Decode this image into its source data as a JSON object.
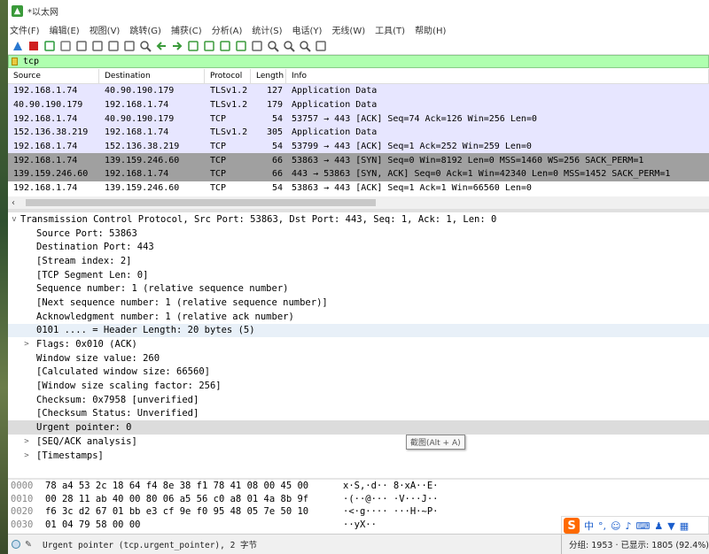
{
  "window": {
    "title": "*以太网"
  },
  "menu": [
    "文件(F)",
    "编辑(E)",
    "视图(V)",
    "跳转(G)",
    "捕获(C)",
    "分析(A)",
    "统计(S)",
    "电话(Y)",
    "无线(W)",
    "工具(T)",
    "帮助(H)"
  ],
  "toolbar_icons": [
    "shark-fin-icon",
    "stop-icon",
    "restart-icon",
    "options-icon",
    "open-icon",
    "save-icon",
    "close-file-icon",
    "reload-icon",
    "find-icon",
    "back-icon",
    "forward-icon",
    "goto-icon",
    "first-icon",
    "last-icon",
    "autoscroll-icon",
    "colorize-icon",
    "zoom-in-icon",
    "zoom-out-icon",
    "zoom-reset-icon",
    "resize-columns-icon"
  ],
  "filter": {
    "value": "tcp"
  },
  "packet_list": {
    "columns": [
      "Source",
      "Destination",
      "Protocol",
      "Length",
      "Info"
    ],
    "rows": [
      {
        "src": "192.168.1.74",
        "dst": "40.90.190.179",
        "proto": "TLSv1.2",
        "len": "127",
        "info": "Application Data",
        "style": "tls"
      },
      {
        "src": "40.90.190.179",
        "dst": "192.168.1.74",
        "proto": "TLSv1.2",
        "len": "179",
        "info": "Application Data",
        "style": "tls"
      },
      {
        "src": "192.168.1.74",
        "dst": "40.90.190.179",
        "proto": "TCP",
        "len": "54",
        "info": "53757 → 443 [ACK] Seq=74 Ack=126 Win=256 Len=0",
        "style": "tls"
      },
      {
        "src": "152.136.38.219",
        "dst": "192.168.1.74",
        "proto": "TLSv1.2",
        "len": "305",
        "info": "Application Data",
        "style": "tls"
      },
      {
        "src": "192.168.1.74",
        "dst": "152.136.38.219",
        "proto": "TCP",
        "len": "54",
        "info": "53799 → 443 [ACK] Seq=1 Ack=252 Win=259 Len=0",
        "style": "tls"
      },
      {
        "src": "192.168.1.74",
        "dst": "139.159.246.60",
        "proto": "TCP",
        "len": "66",
        "info": "53863 → 443 [SYN] Seq=0 Win=8192 Len=0 MSS=1460 WS=256 SACK_PERM=1",
        "style": "syn"
      },
      {
        "src": "139.159.246.60",
        "dst": "192.168.1.74",
        "proto": "TCP",
        "len": "66",
        "info": "443 → 53863 [SYN, ACK] Seq=0 Ack=1 Win=42340 Len=0 MSS=1452 SACK_PERM=1",
        "style": "syn"
      },
      {
        "src": "192.168.1.74",
        "dst": "139.159.246.60",
        "proto": "TCP",
        "len": "54",
        "info": "53863 → 443 [ACK] Seq=1 Ack=1 Win=66560 Len=0",
        "style": "sel"
      }
    ]
  },
  "detail": {
    "header": "Transmission Control Protocol, Src Port: 53863, Dst Port: 443, Seq: 1, Ack: 1, Len: 0",
    "lines": [
      {
        "text": "Source Port: 53863",
        "toggle": ""
      },
      {
        "text": "Destination Port: 443",
        "toggle": ""
      },
      {
        "text": "[Stream index: 2]",
        "toggle": ""
      },
      {
        "text": "[TCP Segment Len: 0]",
        "toggle": ""
      },
      {
        "text": "Sequence number: 1    (relative sequence number)",
        "toggle": ""
      },
      {
        "text": "[Next sequence number: 1    (relative sequence number)]",
        "toggle": ""
      },
      {
        "text": "Acknowledgment number: 1    (relative ack number)",
        "toggle": ""
      },
      {
        "text": "0101 .... = Header Length: 20 bytes (5)",
        "toggle": "",
        "style": "hl"
      },
      {
        "text": "Flags: 0x010 (ACK)",
        "toggle": ">"
      },
      {
        "text": "Window size value: 260",
        "toggle": ""
      },
      {
        "text": "[Calculated window size: 66560]",
        "toggle": ""
      },
      {
        "text": "[Window size scaling factor: 256]",
        "toggle": ""
      },
      {
        "text": "Checksum: 0x7958 [unverified]",
        "toggle": ""
      },
      {
        "text": "[Checksum Status: Unverified]",
        "toggle": ""
      },
      {
        "text": "Urgent pointer: 0",
        "toggle": "",
        "style": "sel"
      },
      {
        "text": "[SEQ/ACK analysis]",
        "toggle": ">"
      },
      {
        "text": "[Timestamps]",
        "toggle": ">"
      }
    ]
  },
  "tooltip": "截图(Alt + A)",
  "hex": [
    {
      "off": "0000",
      "bytes": "78 a4 53 2c 18 64 f4 8e  38 f1 78 41 08 00 45 00",
      "ascii": "x·S,·d··  8·xA··E·"
    },
    {
      "off": "0010",
      "bytes": "00 28 11 ab 40 00 80 06  a5 56 c0 a8 01 4a 8b 9f",
      "ascii": "·(··@···  ·V···J··"
    },
    {
      "off": "0020",
      "bytes": "f6 3c d2 67 01 bb e3 cf  9e f0 95 48 05 7e 50 10",
      "ascii": "·<·g····  ···H·~P·"
    },
    {
      "off": "0030",
      "bytes": "01 04 79 58 00 00",
      "ascii": "··yX··"
    }
  ],
  "status": {
    "message": "Urgent pointer (tcp.urgent_pointer), 2 字节",
    "right": "分组: 1953 · 已显示: 1805 (92.4%)"
  },
  "ime": {
    "logo": "S",
    "lang": "中"
  }
}
